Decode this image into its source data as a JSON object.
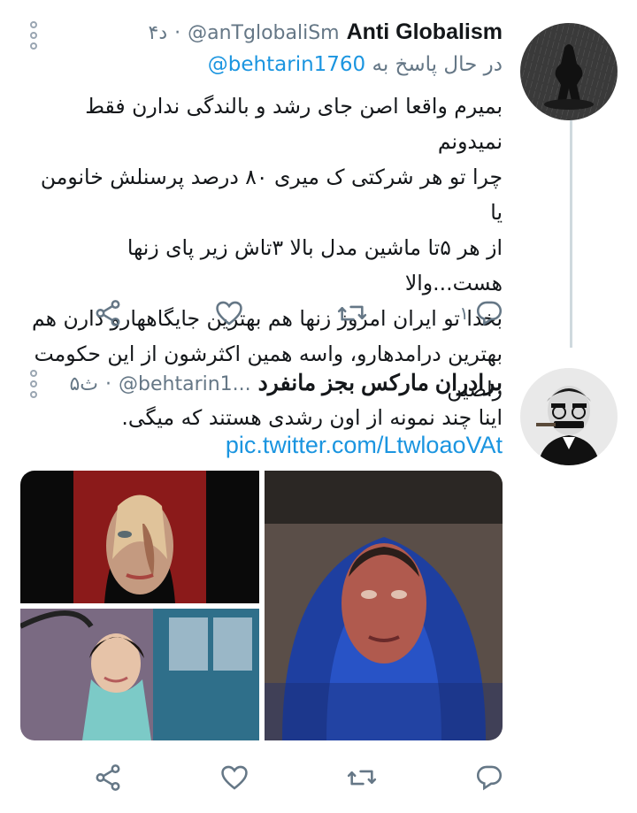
{
  "tweets": [
    {
      "name": "Anti Globalism",
      "handle": "@anTglobaliSm",
      "time": "۴د",
      "replying_prefix": "در حال پاسخ به",
      "replying_to": "@behtarin1760",
      "text_lines": [
        "بمیرم واقعا اصن جای رشد و بالندگی ندارن فقط نمیدونم",
        "چرا تو هر شرکتی ک میری ۸۰ درصد پرسنلش خانومن یا",
        "از هر ۵تا ماشین مدل بالا ۳تاش زیر پای زنها هست...والا",
        "بخدا تو ایران امروز زنها هم بهترین جایگاههارو دارن هم",
        "بهترین درامدهارو، واسه همین اکثرشون از این حکومت",
        "راضین"
      ],
      "reply_count": "۱"
    },
    {
      "name": "برادران مارکس بجز مانفرد",
      "handle": "@behtarin1...",
      "time": "۵ث",
      "text": "اینا چند نمونه از اون رشدی هستند که میگی.",
      "link": "pic.twitter.com/LtwloaoVAt"
    }
  ],
  "icons": {
    "more": "more-vertical-icon",
    "reply": "comment-icon",
    "retweet": "retweet-icon",
    "like": "heart-icon",
    "share": "share-icon"
  },
  "colors": {
    "link": "#1b95e0",
    "secondary_text": "#657786",
    "thread_line": "#cfd9de"
  }
}
